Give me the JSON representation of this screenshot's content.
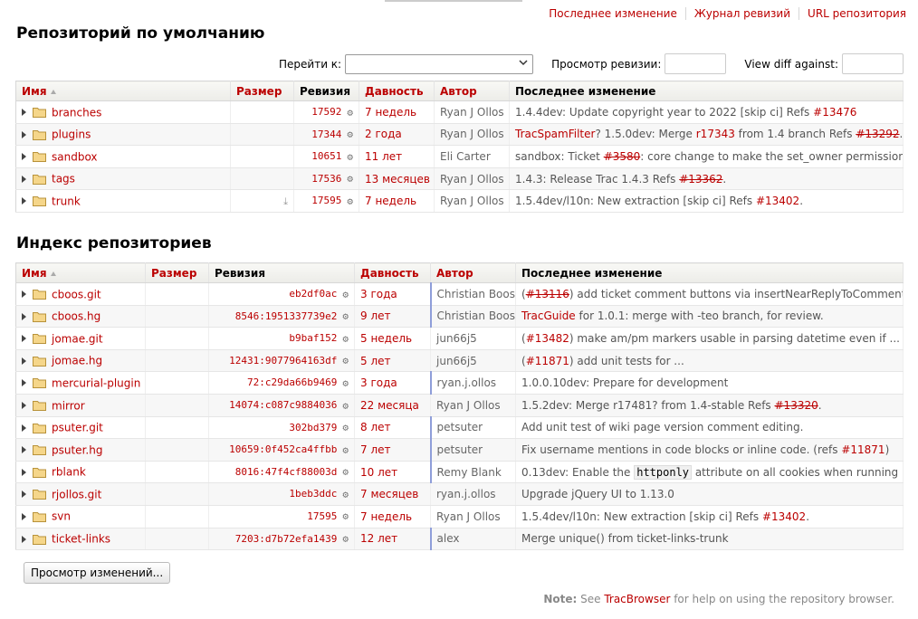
{
  "ctxnav": [
    "Последнее изменение",
    "Журнал ревизий",
    "URL репозитория"
  ],
  "heading_default": "Репозиторий по умолчанию",
  "heading_index": "Индекс репозиториев",
  "controls": {
    "goto_label": "Перейти к:",
    "view_rev_label": "Просмотр ревизии:",
    "view_diff_label": "View diff against:"
  },
  "columns_default": [
    "Имя",
    "Размер",
    "Ревизия",
    "Давность",
    "Автор",
    "Последнее изменение"
  ],
  "columns_index": [
    "Имя",
    "Размер",
    "Ревизия",
    "Давность",
    "Автор",
    "Последнее изменение"
  ],
  "default_rows": [
    {
      "name": "branches",
      "size": "",
      "rev": "17592",
      "age": "7 недель",
      "author": "Ryan J Ollos",
      "change": [
        {
          "t": "1.4.4dev: Update copyright year to 2022 [skip ci] Refs "
        },
        {
          "t": "#13476",
          "link": true
        }
      ]
    },
    {
      "name": "plugins",
      "size": "",
      "rev": "17344",
      "age": "2 года",
      "author": "Ryan J Ollos",
      "change": [
        {
          "t": "TracSpamFilter",
          "link": true
        },
        {
          "t": "? 1.5.0dev: Merge "
        },
        {
          "t": "r17343",
          "link": true
        },
        {
          "t": " from 1.4 branch Refs "
        },
        {
          "t": "#13292",
          "link": true,
          "closed": true
        },
        {
          "t": "."
        }
      ]
    },
    {
      "name": "sandbox",
      "size": "",
      "rev": "10651",
      "age": "11 лет",
      "author": "Eli Carter",
      "change": [
        {
          "t": "sandbox: Ticket "
        },
        {
          "t": "#3580",
          "link": true,
          "closed": true
        },
        {
          "t": ": core change to make the set_owner permission ..."
        }
      ]
    },
    {
      "name": "tags",
      "size": "",
      "rev": "17536",
      "age": "13 месяцев",
      "author": "Ryan J Ollos",
      "change": [
        {
          "t": "1.4.3: Release Trac 1.4.3 Refs "
        },
        {
          "t": "#13362",
          "link": true,
          "closed": true
        },
        {
          "t": "."
        }
      ]
    },
    {
      "name": "trunk",
      "size": "⤓",
      "rev": "17595",
      "age": "7 недель",
      "author": "Ryan J Ollos",
      "change": [
        {
          "t": "1.5.4dev/l10n: New extraction [skip ci] Refs "
        },
        {
          "t": "#13402",
          "link": true
        },
        {
          "t": "."
        }
      ]
    }
  ],
  "index_rows": [
    {
      "name": "cboos.git",
      "rev": "eb2df0ac",
      "age": "3 года",
      "author": "Christian Boos",
      "change": [
        {
          "t": "("
        },
        {
          "t": "#13116",
          "link": true,
          "closed": true
        },
        {
          "t": ") add ticket comment buttons via insertNearReplyToComment ..."
        }
      ],
      "blue": true
    },
    {
      "name": "cboos.hg",
      "rev": "8546:1951337739e2",
      "age": "9 лет",
      "author": "Christian Boos",
      "change": [
        {
          "t": "TracGuide",
          "link": true
        },
        {
          "t": " for 1.0.1: merge with -teo branch, for review."
        }
      ],
      "blue": true
    },
    {
      "name": "jomae.git",
      "rev": "b9baf152",
      "age": "5 недель",
      "author": "jun66j5",
      "change": [
        {
          "t": "("
        },
        {
          "t": "#13482",
          "link": true
        },
        {
          "t": ") make am/pm markers usable in parsing datetime even if ..."
        }
      ],
      "blue": false
    },
    {
      "name": "jomae.hg",
      "rev": "12431:9077964163df",
      "age": "5 лет",
      "author": "jun66j5",
      "change": [
        {
          "t": "("
        },
        {
          "t": "#11871",
          "link": true
        },
        {
          "t": ") add unit tests for ..."
        }
      ],
      "blue": false
    },
    {
      "name": "mercurial-plugin",
      "rev": "72:c29da66b9469",
      "age": "3 года",
      "author": "ryan.j.ollos",
      "change": [
        {
          "t": "1.0.0.10dev: Prepare for development"
        }
      ],
      "blue": true
    },
    {
      "name": "mirror",
      "rev": "14074:c087c9884036",
      "age": "22 месяца",
      "author": "Ryan J Ollos",
      "change": [
        {
          "t": "1.5.2dev: Merge r17481? from 1.4-stable Refs "
        },
        {
          "t": "#13320",
          "link": true,
          "closed": true
        },
        {
          "t": "."
        }
      ],
      "blue": false
    },
    {
      "name": "psuter.git",
      "rev": "302bd379",
      "age": "8 лет",
      "author": "petsuter",
      "change": [
        {
          "t": "Add unit test of wiki page version comment editing."
        }
      ],
      "blue": true
    },
    {
      "name": "psuter.hg",
      "rev": "10659:0f452ca4ffbb",
      "age": "7 лет",
      "author": "petsuter",
      "change": [
        {
          "t": "Fix username mentions in code blocks or inline code. (refs "
        },
        {
          "t": "#11871",
          "link": true
        },
        {
          "t": ")"
        }
      ],
      "blue": true
    },
    {
      "name": "rblank",
      "rev": "8016:47f4cf88003d",
      "age": "10 лет",
      "author": "Remy Blank",
      "change": [
        {
          "t": "0.13dev: Enable the "
        },
        {
          "t": "httponly",
          "code": true
        },
        {
          "t": " attribute on all cookies when running ..."
        }
      ],
      "blue": true
    },
    {
      "name": "rjollos.git",
      "rev": "1beb3ddc",
      "age": "7 месяцев",
      "author": "ryan.j.ollos",
      "change": [
        {
          "t": "Upgrade jQuery UI to 1.13.0"
        }
      ],
      "blue": false
    },
    {
      "name": "svn",
      "rev": "17595",
      "age": "7 недель",
      "author": "Ryan J Ollos",
      "change": [
        {
          "t": "1.5.4dev/l10n: New extraction [skip ci] Refs "
        },
        {
          "t": "#13402",
          "link": true
        },
        {
          "t": "."
        }
      ],
      "blue": false
    },
    {
      "name": "ticket-links",
      "rev": "7203:d7b72efa1439",
      "age": "12 лет",
      "author": "alex",
      "change": [
        {
          "t": "Merge unique() from ticket-links-trunk"
        }
      ],
      "blue": true
    }
  ],
  "button_label": "Просмотр изменений...",
  "hint": {
    "note": "Note:",
    "pre": " See ",
    "link": "TracBrowser",
    "post": " for help on using the repository browser."
  },
  "colors": {
    "link": "#b00000",
    "age_border_red": "#d98a8a",
    "age_border_blue": "#8f9ed9"
  },
  "icons": {
    "folder": "folder-icon",
    "expand": "expand-triangle-icon",
    "gear": "gear-icon",
    "download": "download-icon"
  }
}
